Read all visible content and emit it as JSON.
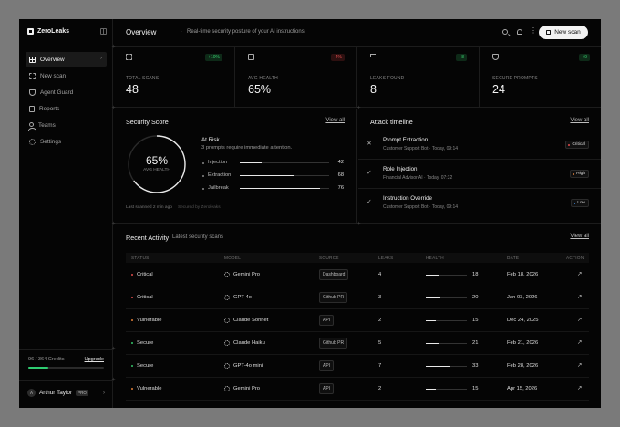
{
  "brand": {
    "name": "ZeroLeaks"
  },
  "sidebar": {
    "items": [
      {
        "label": "Overview",
        "icon": "grid-icon",
        "active": true
      },
      {
        "label": "New scan",
        "icon": "scan-icon"
      },
      {
        "label": "Agent Guard",
        "icon": "shield-icon"
      },
      {
        "label": "Reports",
        "icon": "document-icon"
      },
      {
        "label": "Teams",
        "icon": "users-icon"
      },
      {
        "label": "Settings",
        "icon": "gear-icon"
      }
    ],
    "credits": {
      "text": "96 / 364 Credits",
      "upgrade": "Upgrade",
      "used_fraction": 0.26
    },
    "user": {
      "initials": "A",
      "name": "Arthur Taylor",
      "badge": "PRO"
    }
  },
  "header": {
    "title": "Overview",
    "subtitle": "Real-time security posture of your AI instructions.",
    "new_scan": "New scan"
  },
  "stats": [
    {
      "label": "TOTAL SCANS",
      "value": "48",
      "delta": "+10%",
      "trend": "up",
      "icon": "scan-icon"
    },
    {
      "label": "AVG HEALTH",
      "value": "65%",
      "delta": "-4%",
      "trend": "down",
      "icon": "pulse-icon"
    },
    {
      "label": "LEAKS FOUND",
      "value": "8",
      "delta": "+8",
      "trend": "up",
      "icon": "flag-icon"
    },
    {
      "label": "SECURE PROMPTS",
      "value": "24",
      "delta": "+9",
      "trend": "up",
      "icon": "shield-icon"
    }
  ],
  "score": {
    "title": "Security Score",
    "view_all": "View all",
    "value": "65%",
    "ring_sub": "AVG HEALTH",
    "ring_fraction": 0.65,
    "status": "At Risk",
    "status_sub": "3 prompts require immediate attention.",
    "metrics": [
      {
        "label": "Injection",
        "value": "42",
        "fraction": 0.24
      },
      {
        "label": "Extraction",
        "value": "68",
        "fraction": 0.6
      },
      {
        "label": "Jailbreak",
        "value": "76",
        "fraction": 0.9
      }
    ],
    "last_scanned": "Last scanned 2 min ago",
    "secured_by": "Secured by Zeroleaks"
  },
  "timeline": {
    "title": "Attack timeline",
    "view_all": "View all",
    "items": [
      {
        "title": "Prompt Extraction",
        "sub": "Customer Support Bot · Today, 09:14",
        "severity": "Critical",
        "color": "#e14c4c",
        "icon": "x-icon",
        "glyph": "✕"
      },
      {
        "title": "Role Injection",
        "sub": "Financial Advisor AI · Today, 07:32",
        "severity": "High",
        "color": "#e2813a",
        "icon": "check-icon",
        "glyph": "✓"
      },
      {
        "title": "Instruction Override",
        "sub": "Customer Support Bot · Today, 09:14",
        "severity": "Low",
        "color": "#3e8be0",
        "icon": "check-icon",
        "glyph": "✓"
      }
    ]
  },
  "activity": {
    "title": "Recent Activity",
    "subtitle": "Latest security scans",
    "view_all": "View all",
    "columns": [
      "STATUS",
      "MODEL",
      "SOURCE",
      "LEAKS",
      "HEALTH",
      "DATE",
      "ACTION"
    ],
    "rows": [
      {
        "status": "Critical",
        "color": "#e14c4c",
        "model": "Gemini Pro",
        "source": "Dashboard",
        "leaks": "4",
        "health": "18",
        "health_fraction": 0.3,
        "date": "Feb 18, 2026"
      },
      {
        "status": "Critical",
        "color": "#e14c4c",
        "model": "GPT-4o",
        "source": "Github PR",
        "leaks": "3",
        "health": "20",
        "health_fraction": 0.35,
        "date": "Jan 03, 2026"
      },
      {
        "status": "Vulnerable",
        "color": "#e2813a",
        "model": "Claude Sonnet",
        "source": "API",
        "leaks": "2",
        "health": "15",
        "health_fraction": 0.25,
        "date": "Dec 24, 2025"
      },
      {
        "status": "Secure",
        "color": "#35c76a",
        "model": "Claude Haiku",
        "source": "Github PR",
        "leaks": "5",
        "health": "21",
        "health_fraction": 0.3,
        "date": "Feb 21, 2026"
      },
      {
        "status": "Secure",
        "color": "#35c76a",
        "model": "GPT-4o mini",
        "source": "API",
        "leaks": "7",
        "health": "33",
        "health_fraction": 0.6,
        "date": "Feb 28, 2026"
      },
      {
        "status": "Vulnerable",
        "color": "#e2813a",
        "model": "Gemini Pro",
        "source": "API",
        "leaks": "2",
        "health": "15",
        "health_fraction": 0.25,
        "date": "Apr 15, 2026"
      }
    ],
    "action_glyph": "↗"
  }
}
